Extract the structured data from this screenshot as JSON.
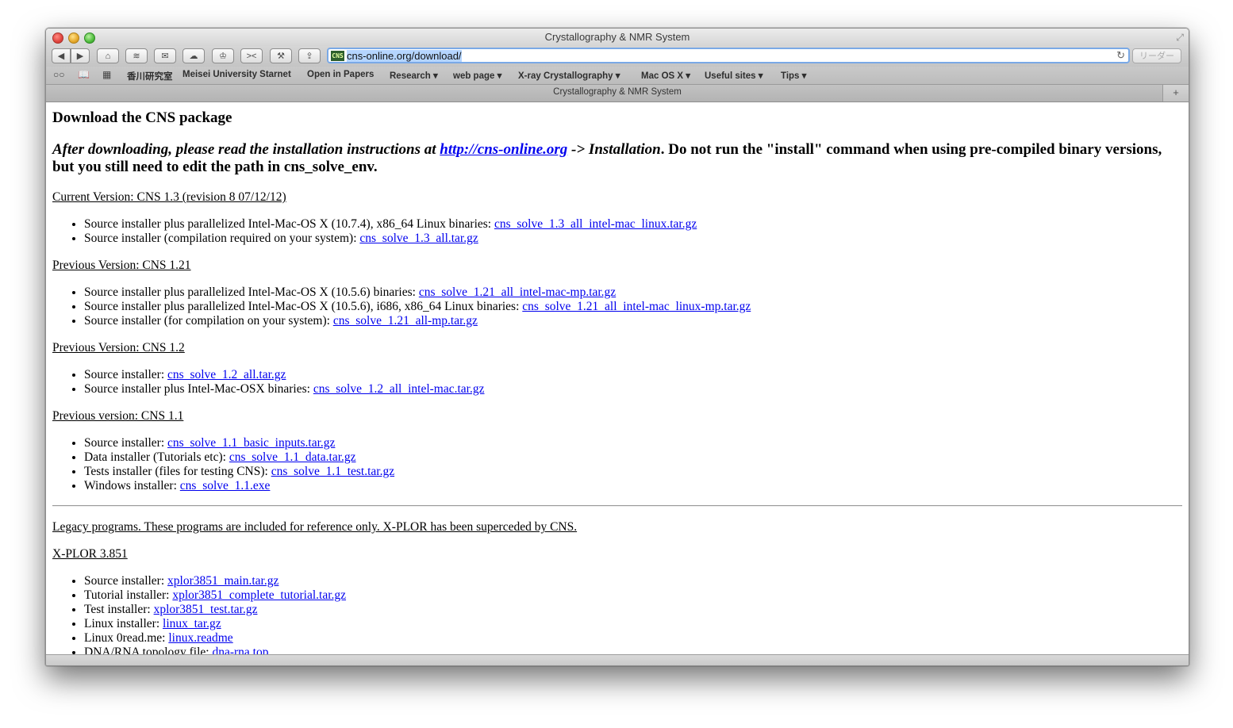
{
  "window": {
    "title": "Crystallography & NMR System"
  },
  "toolbar": {
    "url": "cns-online.org/download/",
    "favicon_text": "CNS",
    "reader_label": "リーダー",
    "buttons": [
      "back-icon",
      "forward-icon",
      "home-icon",
      "rss-icon",
      "mail-icon",
      "cloud-icon",
      "crown-icon",
      "collapse-icon",
      "wrench-icon",
      "share-icon"
    ]
  },
  "bookmarks": {
    "items": [
      {
        "label": "香川研究室",
        "menu": false
      },
      {
        "label": "Meisei University Starnet",
        "menu": false
      },
      {
        "label": "Open in Papers",
        "menu": false
      },
      {
        "label": "Research",
        "menu": true
      },
      {
        "label": "web page",
        "menu": true
      },
      {
        "label": "X-ray Crystallography",
        "menu": true
      },
      {
        "label": "Mac OS X",
        "menu": true
      },
      {
        "label": "Useful sites",
        "menu": true
      },
      {
        "label": "Tips",
        "menu": true
      }
    ]
  },
  "tab": {
    "title": "Crystallography & NMR System"
  },
  "page": {
    "heading": "Download the CNS package",
    "note": {
      "italic1": "After downloading, please read the installation instructions at ",
      "link": "http://cns-online.org",
      "italic2": " -> Installation",
      "rest": ". Do not run the \"install\" command when using pre-compiled binary versions, but you still need to edit the path in cns_solve_env."
    },
    "sections": [
      {
        "title": "Current Version: CNS 1.3 (revision 8 07/12/12)",
        "items": [
          {
            "text": "Source installer plus parallelized Intel-Mac-OS X (10.7.4), x86_64 Linux binaries: ",
            "link": "cns_solve_1.3_all_intel-mac_linux.tar.gz"
          },
          {
            "text": "Source installer (compilation required on your system): ",
            "link": "cns_solve_1.3_all.tar.gz"
          }
        ]
      },
      {
        "title": "Previous Version: CNS 1.21",
        "items": [
          {
            "text": "Source installer plus parallelized Intel-Mac-OS X (10.5.6) binaries: ",
            "link": "cns_solve_1.21_all_intel-mac-mp.tar.gz"
          },
          {
            "text": "Source installer plus parallelized Intel-Mac-OS X (10.5.6), i686, x86_64 Linux binaries: ",
            "link": "cns_solve_1.21_all_intel-mac_linux-mp.tar.gz"
          },
          {
            "text": "Source installer (for compilation on your system): ",
            "link": "cns_solve_1.21_all-mp.tar.gz"
          }
        ]
      },
      {
        "title": "Previous Version: CNS 1.2",
        "items": [
          {
            "text": "Source installer: ",
            "link": "cns_solve_1.2_all.tar.gz"
          },
          {
            "text": "Source installer plus Intel-Mac-OSX binaries: ",
            "link": "cns_solve_1.2_all_intel-mac.tar.gz"
          }
        ]
      },
      {
        "title": "Previous version: CNS 1.1",
        "items": [
          {
            "text": "Source installer: ",
            "link": "cns_solve_1.1_basic_inputs.tar.gz"
          },
          {
            "text": "Data installer (Tutorials etc): ",
            "link": "cns_solve_1.1_data.tar.gz"
          },
          {
            "text": "Tests installer (files for testing CNS): ",
            "link": "cns_solve_1.1_test.tar.gz"
          },
          {
            "text": "Windows installer: ",
            "link": "cns_solve_1.1.exe"
          }
        ]
      }
    ],
    "legacy_note": "Legacy programs. These programs are included for reference only. X-PLOR has been superceded by CNS.",
    "xplor": {
      "title": "X-PLOR 3.851",
      "items": [
        {
          "text": "Source installer: ",
          "link": "xplor3851_main.tar.gz"
        },
        {
          "text": "Tutorial installer: ",
          "link": "xplor3851_complete_tutorial.tar.gz"
        },
        {
          "text": "Test installer: ",
          "link": "xplor3851_test.tar.gz"
        },
        {
          "text": "Linux installer: ",
          "link": "linux_tar.gz"
        },
        {
          "text": "Linux 0read.me: ",
          "link": "linux.readme"
        },
        {
          "text": "DNA/RNA topology file: ",
          "link": "dna-rna.top"
        }
      ]
    }
  }
}
